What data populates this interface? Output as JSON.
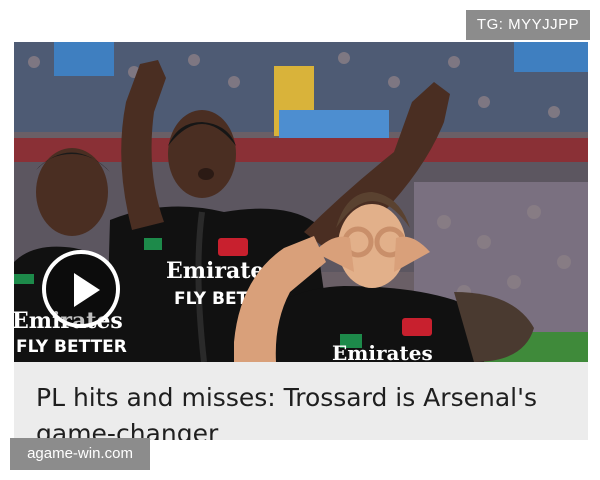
{
  "watermarks": {
    "top": "TG: MYYJJPP",
    "bottom": "agame-win.com"
  },
  "article": {
    "headline": "PL hits and misses: Trossard is Arsenal's game-changer",
    "media_type": "video",
    "play_icon": "play-circle-icon"
  },
  "shirts": {
    "sponsor_main": "Emirates",
    "sponsor_sub": "FLY BETTER"
  },
  "colors": {
    "caption_bg": "#ececec",
    "headline_text": "#1f1f1f",
    "watermark_bg": "#8c8c8c",
    "kit": "#111111",
    "pitch": "#3f8a3a"
  }
}
